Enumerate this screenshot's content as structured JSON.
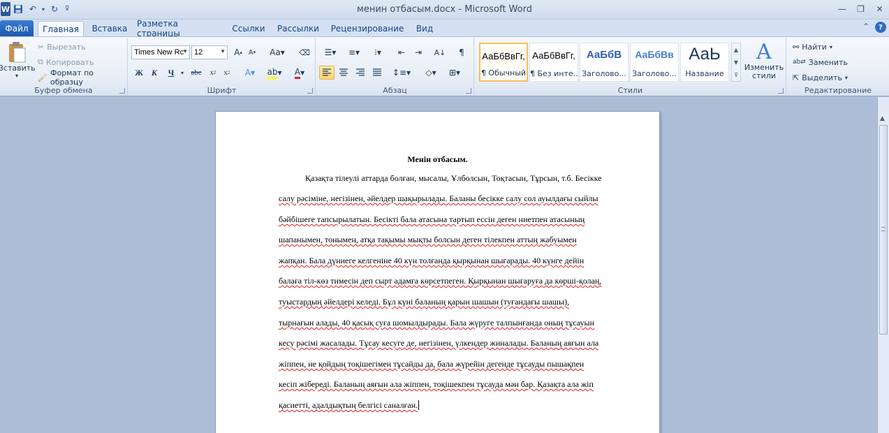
{
  "window": {
    "title": "менин отбасым.docx  -  Microsoft Word"
  },
  "tabs": [
    "Файл",
    "Главная",
    "Вставка",
    "Разметка страницы",
    "Ссылки",
    "Рассылки",
    "Рецензирование",
    "Вид"
  ],
  "ribbon": {
    "clipboard": {
      "label": "Буфер обмена",
      "paste": "Вставить",
      "cut": "Вырезать",
      "copy": "Копировать",
      "format_painter": "Формат по образцу"
    },
    "font": {
      "label": "Шрифт",
      "font_name": "Times New Rc",
      "font_size": "12"
    },
    "paragraph": {
      "label": "Абзац"
    },
    "styles": {
      "label": "Стили",
      "items": [
        {
          "sample": "АаБбВвГг,",
          "name": "¶ Обычный"
        },
        {
          "sample": "АаБбВвГг,",
          "name": "¶ Без инте..."
        },
        {
          "sample": "АаБбВ",
          "name": "Заголово..."
        },
        {
          "sample": "АаБбВв",
          "name": "Заголово..."
        },
        {
          "sample": "АаЬ",
          "name": "Название"
        }
      ],
      "change_styles": "Изменить стили"
    },
    "editing": {
      "label": "Редактирование",
      "find": "Найти",
      "replace": "Заменить",
      "select": "Выделить"
    }
  },
  "document": {
    "title": "Менін отбасым.",
    "lines": [
      "Қазақта тілеулі аттарда болған, мысалы, Ұлболсын, Тоқтасын, Тұрсын, т.б. Бесікке",
      "салу рәсіміне, негізінен, әйелдер шақырылады. Баланы бесікке салу сол ауылдағы сыйлы",
      "бәйбішеге тапсырылатын. Бесікті бала атасына тартып ессін деген ниетпен атасының",
      "шапанымен, тонымен, атқа тақымы мықты болсын деген тілекпен аттың жабуымен",
      "жапқан. Бала дүниеге келгеніне 40 күн толғанда қырқынан шығарады. 40 күнге дейін",
      "балаға тіл-көз тимесін деп сырт адамға көрсетпеген. Қырқынан шығаруға да көрші-қолаң,",
      "туыстардың әйелдері келеді. Бұл күні баланың қарын шашын (туғандағы шашы),",
      "тырнағын алады, 40 қасық суға шомылдырады. Бала жүруге талпынғанда оның тұсауын",
      "кесу рәсімі  жасалады. Тұсау кесуге де, негізінен, үлкендер жиналады. Баланың аяғын ала",
      "жіппен, не қойдың тоқішегімен  тұсайды да, бала жүрейін дегенде тұсауды пышақпен",
      "кесіп жібереді. Баланың аяғын ала жіппен, тоқішекпен тұсауда мән бар. Қазақта ала жіп",
      "қасиетті, адалдықтың белгісі саналған."
    ]
  }
}
